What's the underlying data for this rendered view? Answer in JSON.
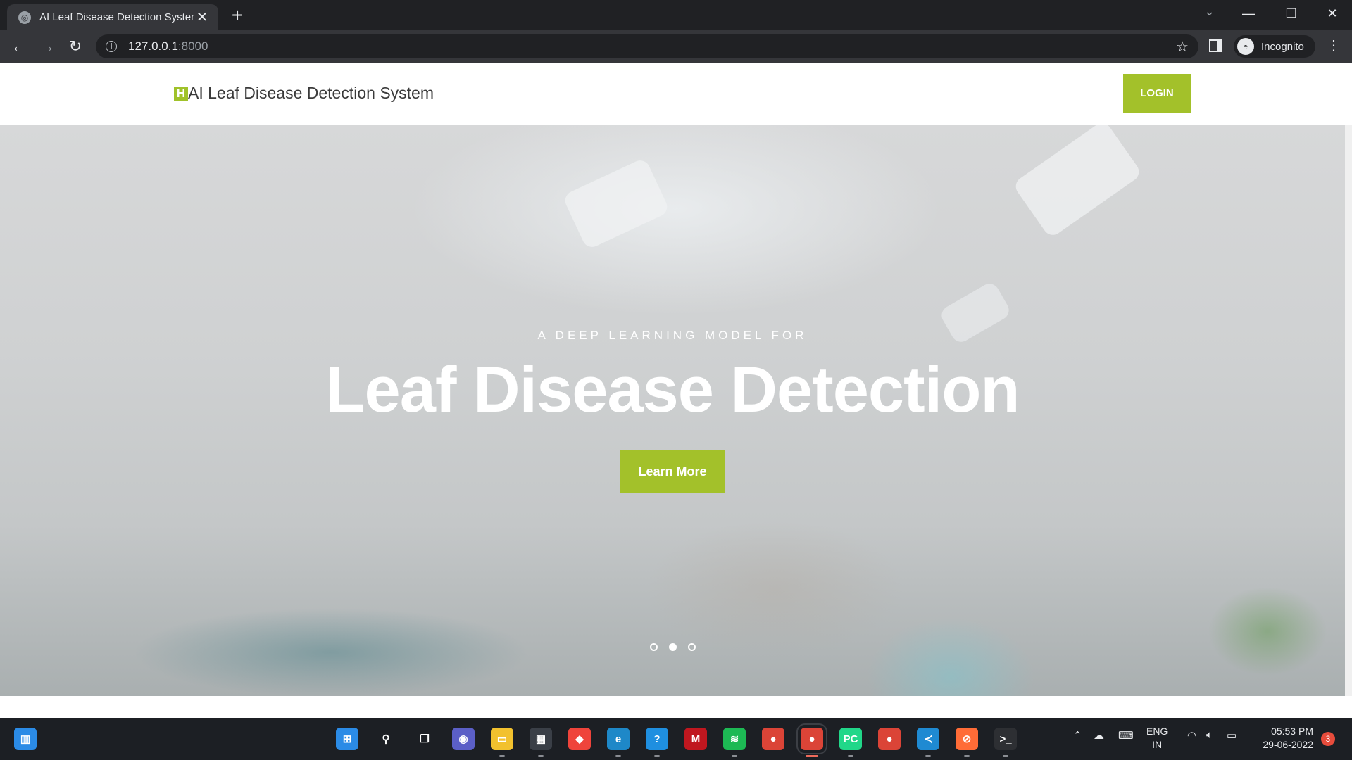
{
  "browser": {
    "tab_title": "AI Leaf Disease Detection System",
    "tab_close": "✕",
    "new_tab": "+",
    "url_host": "127.0.0.1",
    "url_port": ":8000",
    "profile_label": "Incognito",
    "back": "←",
    "forward": "→",
    "reload": "↻",
    "star": "☆",
    "menu": "⋮",
    "tab_search": "⌄",
    "minimize": "—",
    "restore": "❐",
    "close": "✕"
  },
  "site": {
    "logo_letter": "H",
    "brand": "AI Leaf Disease Detection System",
    "login_label": "LOGIN"
  },
  "hero": {
    "subtitle": "A DEEP LEARNING MODEL FOR",
    "title": "Leaf Disease Detection",
    "button_label": "Learn More",
    "active_slide": 2,
    "slide_count": 3
  },
  "taskbar": {
    "apps": [
      {
        "name": "windows-start",
        "color": "#2b8be6",
        "glyph": "⊞"
      },
      {
        "name": "search",
        "color": "transparent",
        "glyph": "⚲"
      },
      {
        "name": "task-view",
        "color": "transparent",
        "glyph": "❐"
      },
      {
        "name": "teams-chat",
        "color": "#5b5fc7",
        "glyph": "◉"
      },
      {
        "name": "file-explorer",
        "color": "#f2c12e",
        "glyph": "▭"
      },
      {
        "name": "microsoft-store",
        "color": "#3a3f47",
        "glyph": "▦"
      },
      {
        "name": "anydesk",
        "color": "#ef443b",
        "glyph": "◆"
      },
      {
        "name": "edge",
        "color": "#1e88c8",
        "glyph": "e"
      },
      {
        "name": "help",
        "color": "#1f8fe0",
        "glyph": "?"
      },
      {
        "name": "mcafee",
        "color": "#c0171f",
        "glyph": "M"
      },
      {
        "name": "spotify",
        "color": "#1db954",
        "glyph": "≋"
      },
      {
        "name": "chrome",
        "color": "#db4437",
        "glyph": "●"
      },
      {
        "name": "chrome-profile-a",
        "color": "#db4437",
        "glyph": "●"
      },
      {
        "name": "pycharm",
        "color": "#21d789",
        "glyph": "PC"
      },
      {
        "name": "chrome-profile-f",
        "color": "#db4437",
        "glyph": "●"
      },
      {
        "name": "vscode",
        "color": "#1f8ad2",
        "glyph": "≺"
      },
      {
        "name": "postman",
        "color": "#ff6c37",
        "glyph": "⊘"
      },
      {
        "name": "terminal",
        "color": "#2d2f33",
        "glyph": ">_"
      }
    ],
    "lang_line1": "ENG",
    "lang_line2": "IN",
    "time": "05:53 PM",
    "date": "29-06-2022",
    "notifications": "3"
  }
}
